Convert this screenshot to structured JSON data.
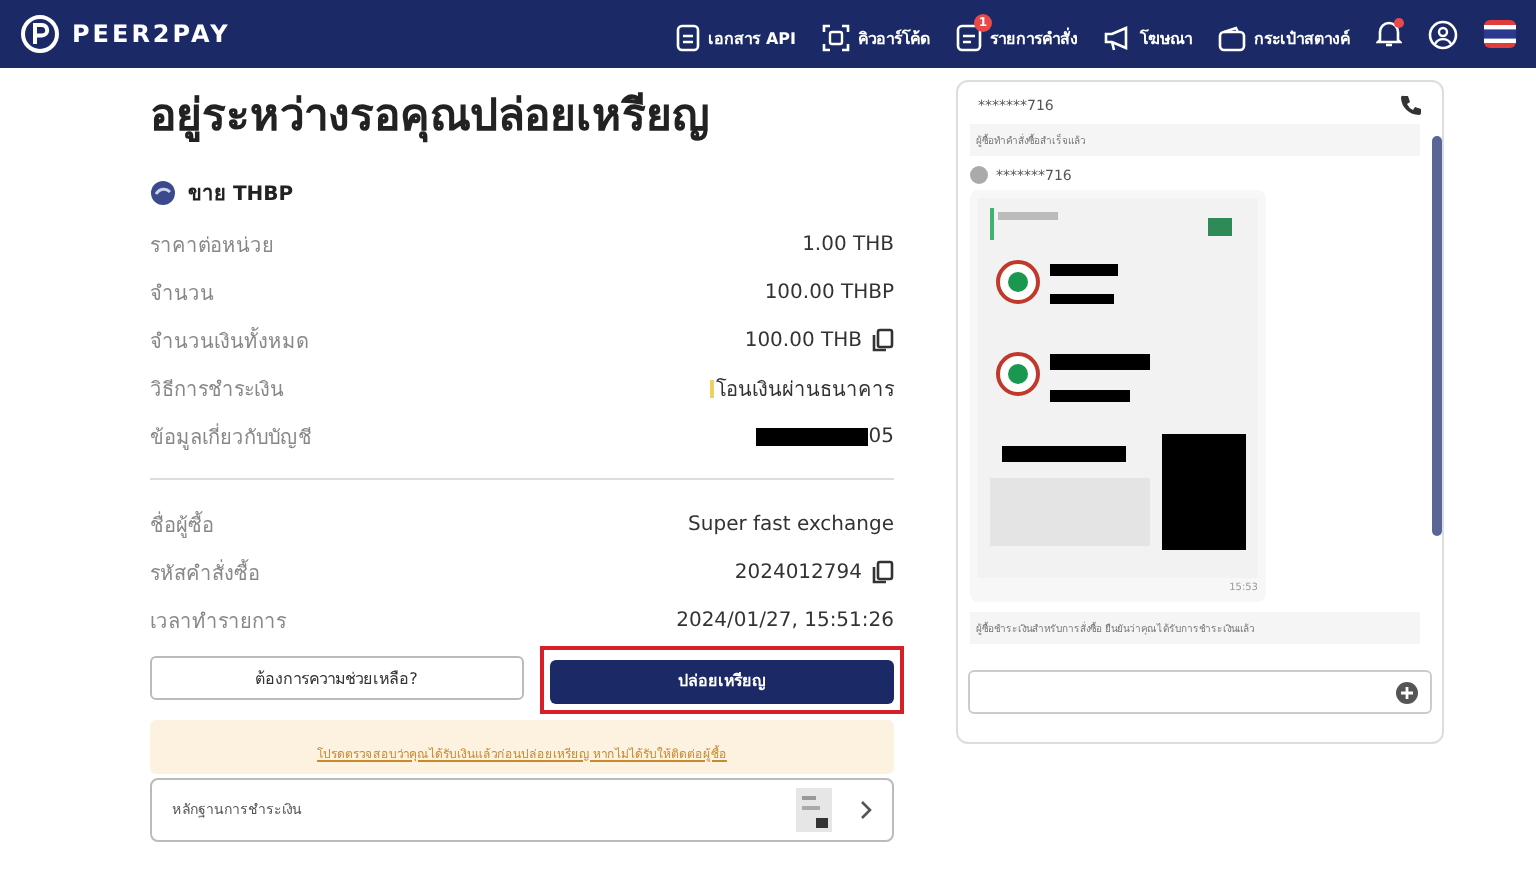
{
  "header": {
    "logo": "PEER2PAY",
    "nav": [
      {
        "kind": "doc",
        "label": "เอกสาร API"
      },
      {
        "kind": "qr",
        "label": "คิวอาร์โค้ด"
      },
      {
        "kind": "orders",
        "label": "รายการคำสั่ง",
        "badge": "1"
      },
      {
        "kind": "ads",
        "label": "โฆษณา"
      },
      {
        "kind": "wallet",
        "label": "กระเป๋าสตางค์"
      }
    ],
    "notification_dot": true
  },
  "order": {
    "title": "อยู่ระหว่างรอคุณปล่อยเหรียญ",
    "side": "ขาย THBP",
    "details": [
      {
        "label": "ราคาต่อหน่วย",
        "value": "1.00 THB",
        "kind": "text"
      },
      {
        "label": "จำนวน",
        "value": "100.00 THBP",
        "kind": "text"
      },
      {
        "label": "จำนวนเงินทั้งหมด",
        "value": "100.00 THB",
        "kind": "copy"
      },
      {
        "label": "วิธีการชำระเงิน",
        "value": "โอนเงินผ่านธนาคาร",
        "kind": "bank"
      },
      {
        "label": "ข้อมูลเกี่ยวกับบัญชี",
        "value": "05",
        "kind": "redacted"
      }
    ],
    "buyer": [
      {
        "label": "ชื่อผู้ซื้อ",
        "value": "Super fast exchange",
        "kind": "text"
      },
      {
        "label": "รหัสคำสั่งซื้อ",
        "value": "2024012794",
        "kind": "copy"
      },
      {
        "label": "เวลาทำรายการ",
        "value": "2024/01/27, 15:51:26",
        "kind": "text"
      }
    ],
    "help_button": "ต้องการความช่วยเหลือ?",
    "release_button": "ปล่อยเหรียญ",
    "release_highlighted": true,
    "notice": "โปรดตรวจสอบว่าคุณได้รับเงินแล้วก่อนปล่อยเหรียญ หากไม่ได้รับให้ติดต่อผู้ซื้อ",
    "proof": "หลักฐานการชำระเงิน"
  },
  "chat": {
    "contact": "*******716",
    "messages": [
      {
        "kind": "system",
        "text": "ผู้ซื้อทำคำสั่งซื้อสำเร็จแล้ว"
      },
      {
        "sender": "*******716",
        "time": "15:53"
      },
      {
        "kind": "system",
        "text": "ผู้ซื้อชำระเงินสำหรับการสั่งซื้อ ยืนยันว่าคุณได้รับการชำระเงินแล้ว"
      }
    ]
  }
}
